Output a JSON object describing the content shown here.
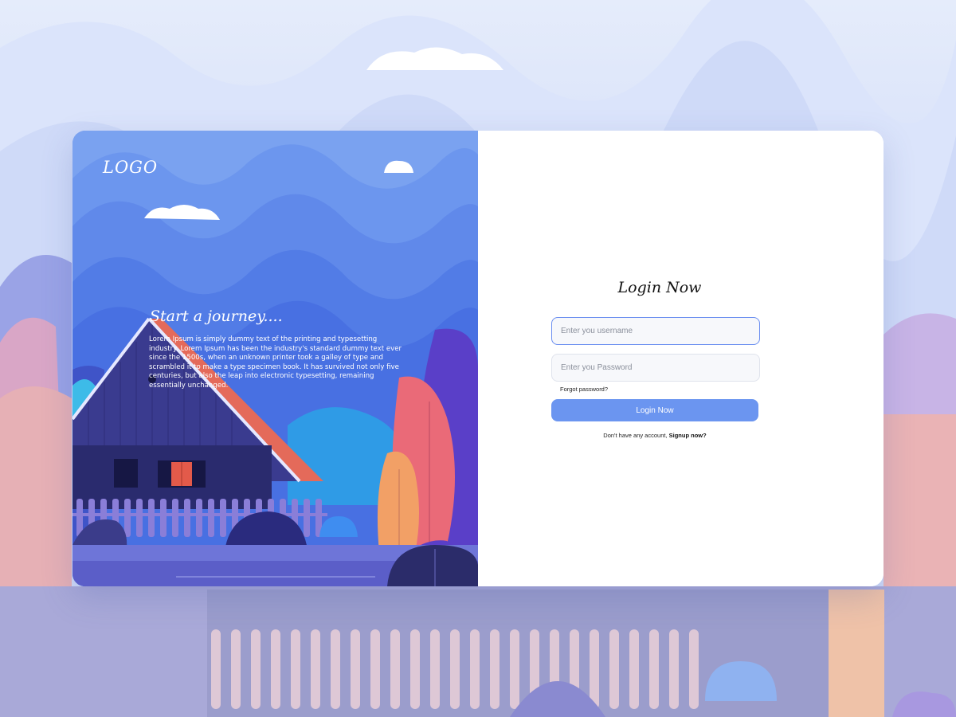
{
  "brand": {
    "logo_text": "LOGO"
  },
  "hero": {
    "title": "Start a journey....",
    "body": "Lorem Ipsum is simply dummy text of the printing and typesetting industry. Lorem Ipsum has been the industry's standard dummy text ever since the 1500s, when an unknown printer took a galley of type and scrambled it to make a type specimen book. It has survived not only five centuries, but also the leap into electronic typesetting, remaining essentially unchanged."
  },
  "login": {
    "title": "Login Now",
    "username": {
      "placeholder": "Enter you username",
      "value": ""
    },
    "password": {
      "placeholder": "Enter you Password",
      "value": ""
    },
    "forgot_label": "Forgot password?",
    "submit_label": "Login Now",
    "signup_prompt": "Don't have any account,",
    "signup_link": "Signup now?"
  },
  "colors": {
    "accent": "#6b95f0",
    "sky": "#4e7ce9",
    "roof": "#e46a5a",
    "house": "#3a3b8f",
    "tree_red": "#ea6a78",
    "tree_orange": "#f2a066"
  }
}
